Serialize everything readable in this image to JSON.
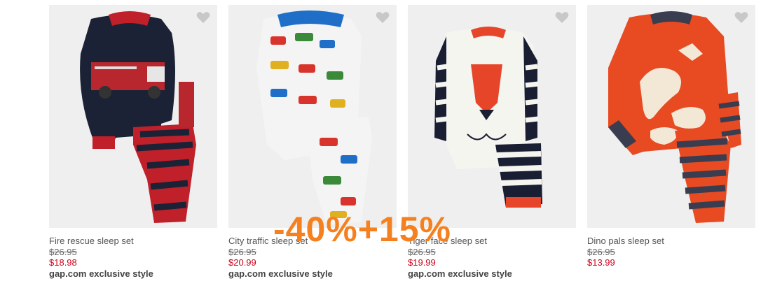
{
  "products": [
    {
      "name": "Fire rescue sleep set",
      "original_price": "$26.95",
      "sale_price": "$18.98",
      "badge": "gap.com exclusive style",
      "image": "fire-truck-pajama-set",
      "favorite_icon": "heart-icon"
    },
    {
      "name": "City traffic sleep set",
      "original_price": "$26.95",
      "sale_price": "$20.99",
      "badge": "gap.com exclusive style",
      "image": "vehicles-print-pajama-set",
      "favorite_icon": "heart-icon"
    },
    {
      "name": "Tiger face sleep set",
      "original_price": "$26.95",
      "sale_price": "$19.99",
      "badge": "gap.com exclusive style",
      "image": "tiger-face-pajama-set",
      "favorite_icon": "heart-icon"
    },
    {
      "name": "Dino pals sleep set",
      "original_price": "$26.95",
      "sale_price": "$13.99",
      "badge": "",
      "image": "dinosaur-skeleton-pajama-set",
      "favorite_icon": "heart-icon"
    }
  ],
  "promo_overlay": "-40%+15%",
  "colors": {
    "sale_price": "#d0021b",
    "promo": "#f5801f",
    "image_bg": "#efefef"
  }
}
